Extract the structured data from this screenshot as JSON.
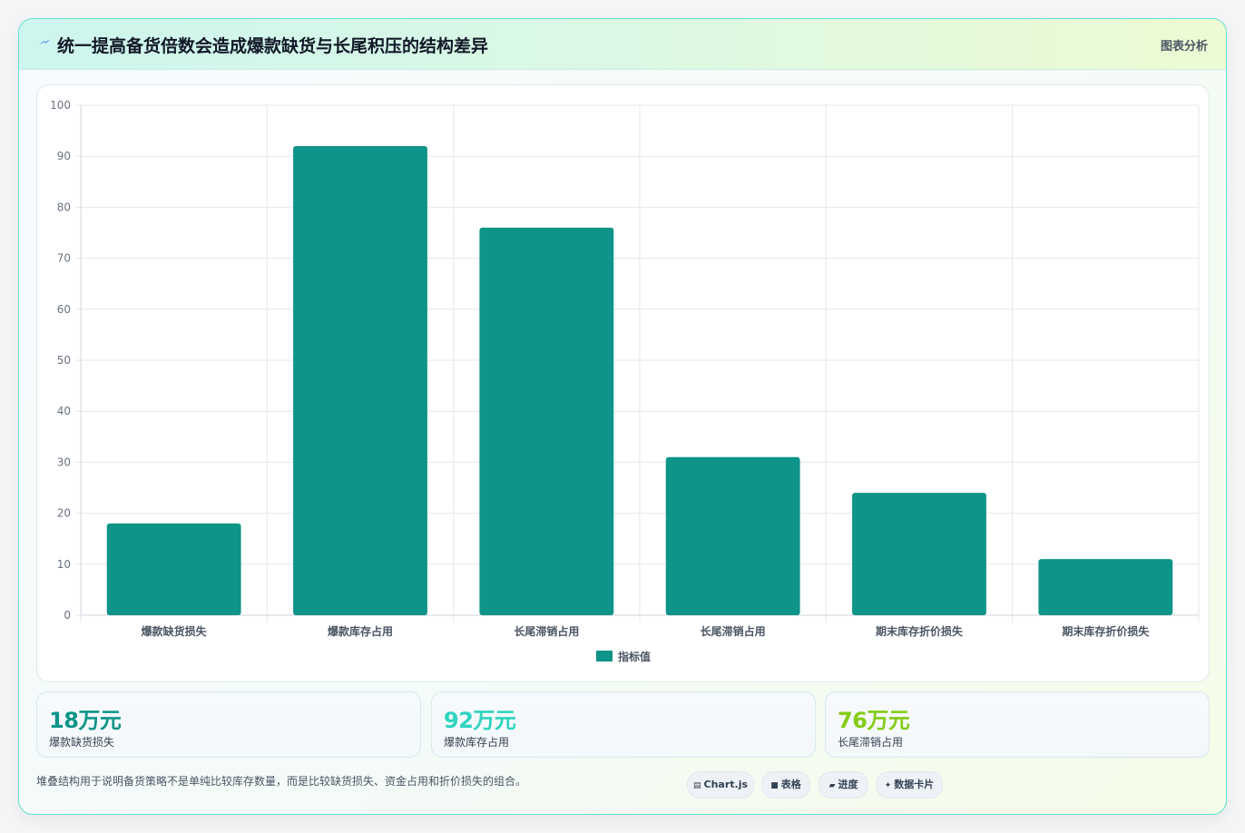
{
  "header": {
    "title": "统一提高备货倍数会造成爆款缺货与长尾积压的结构差异",
    "tag": "图表分析",
    "icon": "lightning-icon"
  },
  "chart_data": {
    "type": "bar",
    "categories": [
      "爆款缺货损失",
      "爆款库存占用",
      "长尾滞销占用",
      "长尾滞销占用",
      "期末库存折价损失",
      "期末库存折价损失"
    ],
    "series": [
      {
        "name": "指标值",
        "values": [
          18,
          92,
          76,
          31,
          24,
          11
        ],
        "color": "#0e9488"
      }
    ],
    "ylim": [
      0,
      100
    ],
    "yticks": [
      0,
      10,
      20,
      30,
      40,
      50,
      60,
      70,
      80,
      90,
      100
    ],
    "grid": true,
    "legend": "bottom",
    "title": "",
    "xlabel": "",
    "ylabel": ""
  },
  "stats": [
    {
      "value": "18万元",
      "label": "爆款缺货损失",
      "color": "#0e9488"
    },
    {
      "value": "92万元",
      "label": "爆款库存占用",
      "color": "#2dd4bf"
    },
    {
      "value": "76万元",
      "label": "长尾滞销占用",
      "color": "#84cc16"
    }
  ],
  "footnote": "堆叠结构用于说明备货策略不是单纯比较库存数量，而是比较缺货损失、资金占用和折价损失的组合。",
  "chips": [
    {
      "label": "Chart.js",
      "glyph": "▤",
      "icon": "chart-icon"
    },
    {
      "label": "表格",
      "glyph": "■",
      "icon": "table-icon"
    },
    {
      "label": "进度",
      "glyph": "▰",
      "icon": "progress-icon"
    },
    {
      "label": "数据卡片",
      "glyph": "✦",
      "icon": "card-icon"
    }
  ]
}
